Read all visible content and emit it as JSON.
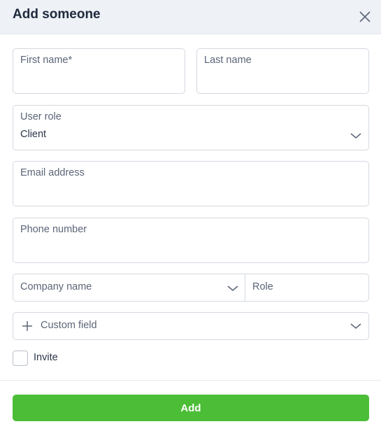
{
  "header": {
    "title": "Add someone",
    "close_icon": "close-icon"
  },
  "form": {
    "first_name": {
      "label": "First name*",
      "value": ""
    },
    "last_name": {
      "label": "Last name",
      "value": ""
    },
    "user_role": {
      "label": "User role",
      "value": "Client",
      "icon": "chevron-down-icon"
    },
    "email": {
      "label": "Email address",
      "value": ""
    },
    "phone": {
      "label": "Phone number",
      "value": ""
    },
    "company": {
      "placeholder": "Company name",
      "icon": "chevron-down-icon"
    },
    "role": {
      "placeholder": "Role"
    },
    "custom_field": {
      "label": "Custom field",
      "icon": "plus-icon"
    },
    "invite": {
      "label": "Invite",
      "checked": false
    }
  },
  "footer": {
    "add_label": "Add"
  },
  "colors": {
    "accent": "#4cbd37",
    "header_bg": "#eef1f6",
    "border": "#d3d8e0"
  }
}
